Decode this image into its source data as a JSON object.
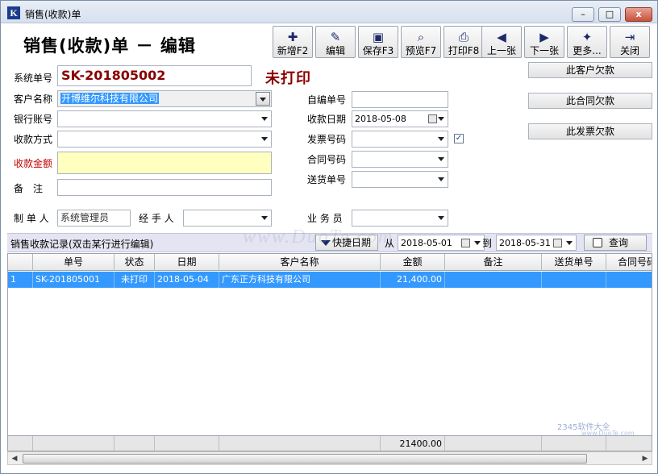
{
  "window": {
    "app_icon_letter": "K",
    "title": "销售(收款)单",
    "min_glyph": "–",
    "max_glyph": "□",
    "close_glyph": "x"
  },
  "form_title": "销售(收款)单 － 编辑",
  "toolbar": [
    {
      "label": "新增F2",
      "icon": "new-doc-icon",
      "glyph": "✚"
    },
    {
      "label": "编辑",
      "icon": "edit-icon",
      "glyph": "✎"
    },
    {
      "label": "保存F3",
      "icon": "save-icon",
      "glyph": "▣"
    },
    {
      "label": "预览F7",
      "icon": "preview-icon",
      "glyph": "⌕"
    },
    {
      "label": "打印F8",
      "icon": "print-icon",
      "glyph": "⎙"
    },
    {
      "label": "上一张",
      "icon": "prev-arrow-icon",
      "glyph": "◀"
    },
    {
      "label": "下一张",
      "icon": "next-arrow-icon",
      "glyph": "▶"
    },
    {
      "label": "更多...",
      "icon": "more-icon",
      "glyph": "✦"
    },
    {
      "label": "关闭",
      "icon": "close-door-icon",
      "glyph": "⇥"
    }
  ],
  "form": {
    "system_no_label": "系统单号",
    "system_no_value": "SK-201805002",
    "status_text": "未打印",
    "customer_label": "客户名称",
    "customer_value": "开博维尔科技有限公司",
    "bank_label": "银行账号",
    "bank_value": "",
    "pay_method_label": "收款方式",
    "pay_method_value": "",
    "amount_label": "收款金额",
    "amount_value": "",
    "remark_label": "备　注",
    "remark_value": "",
    "maker_label": "制 单 人",
    "maker_value": "系统管理员",
    "handler_label": "经 手 人",
    "handler_value": "",
    "self_no_label": "自编单号",
    "self_no_value": "",
    "receipt_date_label": "收款日期",
    "receipt_date_value": "2018-05-08",
    "invoice_label": "发票号码",
    "invoice_value": "",
    "invoice_checked": "✓",
    "contract_label": "合同号码",
    "contract_value": "",
    "delivery_label": "送货单号",
    "delivery_value": "",
    "salesman_label": "业 务 员",
    "salesman_value": ""
  },
  "side_buttons": {
    "customer_debt": "此客户欠款",
    "contract_debt": "此合同欠款",
    "invoice_debt": "此发票欠款"
  },
  "records": {
    "title": "销售收款记录(双击某行进行编辑)",
    "quick_date_label": "快捷日期",
    "from_label": "从",
    "from_date": "2018-05-01",
    "to_label": "到",
    "to_date": "2018-05-31",
    "query_label": "查询",
    "columns": [
      "单号",
      "状态",
      "日期",
      "客户名称",
      "金额",
      "备注",
      "送货单号",
      "合同号码"
    ],
    "rows": [
      {
        "index": "1",
        "no": "SK-201805001",
        "status": "未打印",
        "date": "2018-05-04",
        "customer": "广东正方科技有限公司",
        "amount": "21,400.00",
        "remark": "",
        "delivery": "",
        "contract": ""
      }
    ],
    "total_amount": "21400.00"
  },
  "scroll": {
    "left_glyph": "◀",
    "right_glyph": "▶"
  },
  "watermark": {
    "main": "www.DuoTe.com",
    "logo": "2345软件大全",
    "logo_sub": "www.DuoTe.com"
  }
}
